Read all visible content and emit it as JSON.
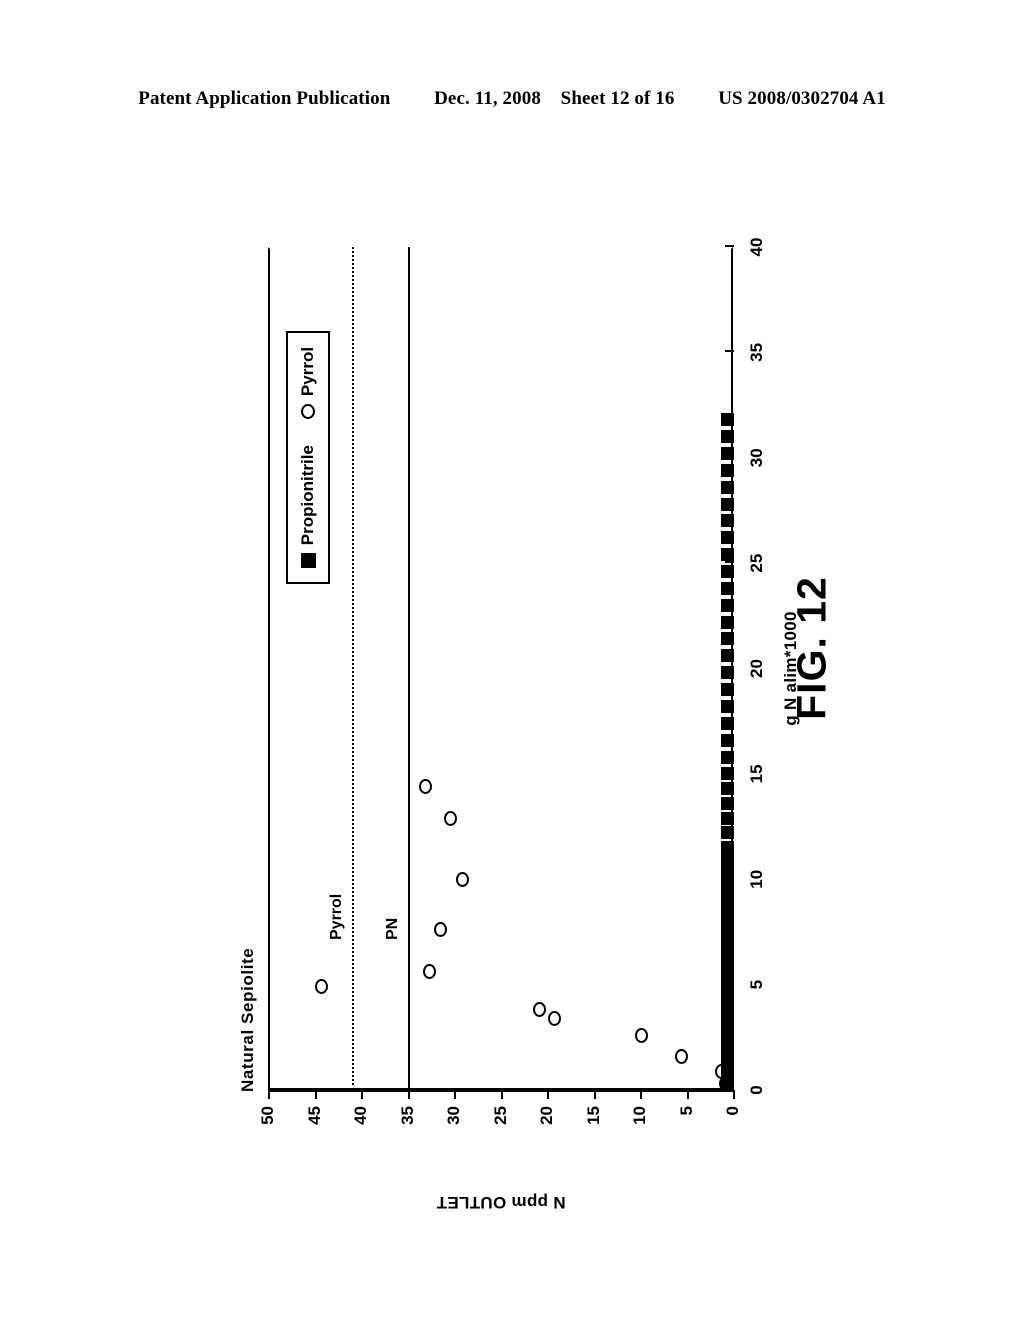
{
  "header": {
    "publication": "Patent Application Publication",
    "date": "Dec. 11, 2008",
    "sheet": "Sheet 12 of 16",
    "patent_number": "US 2008/0302704 A1"
  },
  "figure": {
    "caption": "FIG. 12"
  },
  "colors": {
    "ink": "#000000",
    "paper": "#ffffff"
  },
  "chart_data": {
    "type": "scatter",
    "title": "Natural Sepiolite",
    "xlabel": "g N alim*1000",
    "ylabel": "N ppm OUTLET",
    "xlim": [
      0,
      40
    ],
    "ylim": [
      0,
      50
    ],
    "xticks": [
      0,
      5,
      10,
      15,
      20,
      25,
      30,
      35,
      40
    ],
    "ytick_labels": [
      "0",
      "5",
      "10",
      "15",
      "20",
      "25",
      "30",
      "35",
      "40",
      "45",
      "50"
    ],
    "yticks": [
      0,
      5,
      10,
      15,
      20,
      25,
      30,
      35,
      40,
      45,
      50
    ],
    "grid": false,
    "legend_position": "upper-right-inside",
    "annotations": [
      {
        "text": "Pyrrol",
        "value": 41,
        "style": "dotted",
        "kind": "horizontal-reference-line"
      },
      {
        "text": "PN",
        "value": 35,
        "style": "solid",
        "kind": "horizontal-reference-line"
      }
    ],
    "series": [
      {
        "name": "Propionitrile",
        "marker": "filled-square",
        "points": [
          [
            0.2,
            0.6
          ],
          [
            0.5,
            0.6
          ],
          [
            0.8,
            0.6
          ],
          [
            1.1,
            0.6
          ],
          [
            1.4,
            0.6
          ],
          [
            1.7,
            0.6
          ],
          [
            2.0,
            0.6
          ],
          [
            2.3,
            0.6
          ],
          [
            2.6,
            0.6
          ],
          [
            2.9,
            0.6
          ],
          [
            3.2,
            0.6
          ],
          [
            3.5,
            0.6
          ],
          [
            3.8,
            0.6
          ],
          [
            4.1,
            0.6
          ],
          [
            4.4,
            0.6
          ],
          [
            4.7,
            0.6
          ],
          [
            5.0,
            0.6
          ],
          [
            5.4,
            0.6
          ],
          [
            5.9,
            0.6
          ],
          [
            6.4,
            0.6
          ],
          [
            6.9,
            0.6
          ],
          [
            7.4,
            0.6
          ],
          [
            7.9,
            0.6
          ],
          [
            8.5,
            0.6
          ],
          [
            9.1,
            0.6
          ],
          [
            9.7,
            0.6
          ],
          [
            10.3,
            0.6
          ],
          [
            10.9,
            0.6
          ],
          [
            11.5,
            0.6
          ],
          [
            12.2,
            0.6
          ],
          [
            12.9,
            0.6
          ],
          [
            13.6,
            0.6
          ],
          [
            14.3,
            0.6
          ],
          [
            15.0,
            0.6
          ],
          [
            15.8,
            0.6
          ],
          [
            16.6,
            0.6
          ],
          [
            17.4,
            0.6
          ],
          [
            18.2,
            0.6
          ],
          [
            19.0,
            0.6
          ],
          [
            19.8,
            0.6
          ],
          [
            20.6,
            0.6
          ],
          [
            21.4,
            0.6
          ],
          [
            22.2,
            0.6
          ],
          [
            23.0,
            0.6
          ],
          [
            23.8,
            0.6
          ],
          [
            24.6,
            0.6
          ],
          [
            25.4,
            0.6
          ],
          [
            26.2,
            0.6
          ],
          [
            27.0,
            0.6
          ],
          [
            27.8,
            0.6
          ],
          [
            28.6,
            0.6
          ],
          [
            29.4,
            0.6
          ],
          [
            30.2,
            0.6
          ],
          [
            31.0,
            0.6
          ],
          [
            31.8,
            0.6
          ]
        ]
      },
      {
        "name": "Pyrrol",
        "marker": "open-circle",
        "points": [
          [
            0.3,
            0.8
          ],
          [
            0.9,
            1.2
          ],
          [
            1.6,
            5.5
          ],
          [
            2.6,
            9.8
          ],
          [
            3.4,
            19.2
          ],
          [
            3.8,
            20.8
          ],
          [
            4.9,
            44.3
          ],
          [
            5.6,
            32.6
          ],
          [
            7.6,
            31.4
          ],
          [
            10.0,
            29.1
          ],
          [
            12.9,
            30.4
          ],
          [
            14.4,
            33.1
          ]
        ]
      }
    ]
  }
}
